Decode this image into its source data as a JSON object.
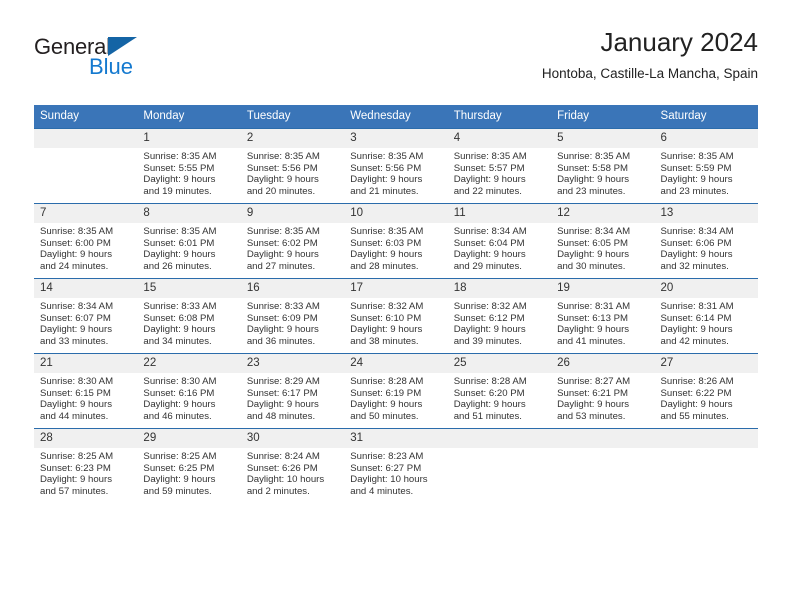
{
  "brand": {
    "name_part1": "General",
    "name_part2": "Blue",
    "accent_color": "#1479cf",
    "triangle_color": "#1464a5"
  },
  "header": {
    "title": "January 2024",
    "subtitle": "Hontoba, Castille-La Mancha, Spain"
  },
  "theme": {
    "header_blue": "#3a75b8",
    "row_line_blue": "#2b6cab",
    "daynum_band": "#f0f0f0"
  },
  "weekday_headers": [
    "Sunday",
    "Monday",
    "Tuesday",
    "Wednesday",
    "Thursday",
    "Friday",
    "Saturday"
  ],
  "weeks": [
    [
      {
        "day": "",
        "sunrise": "",
        "sunset": "",
        "daylight1": "",
        "daylight2": ""
      },
      {
        "day": "1",
        "sunrise": "Sunrise: 8:35 AM",
        "sunset": "Sunset: 5:55 PM",
        "daylight1": "Daylight: 9 hours",
        "daylight2": "and 19 minutes."
      },
      {
        "day": "2",
        "sunrise": "Sunrise: 8:35 AM",
        "sunset": "Sunset: 5:56 PM",
        "daylight1": "Daylight: 9 hours",
        "daylight2": "and 20 minutes."
      },
      {
        "day": "3",
        "sunrise": "Sunrise: 8:35 AM",
        "sunset": "Sunset: 5:56 PM",
        "daylight1": "Daylight: 9 hours",
        "daylight2": "and 21 minutes."
      },
      {
        "day": "4",
        "sunrise": "Sunrise: 8:35 AM",
        "sunset": "Sunset: 5:57 PM",
        "daylight1": "Daylight: 9 hours",
        "daylight2": "and 22 minutes."
      },
      {
        "day": "5",
        "sunrise": "Sunrise: 8:35 AM",
        "sunset": "Sunset: 5:58 PM",
        "daylight1": "Daylight: 9 hours",
        "daylight2": "and 23 minutes."
      },
      {
        "day": "6",
        "sunrise": "Sunrise: 8:35 AM",
        "sunset": "Sunset: 5:59 PM",
        "daylight1": "Daylight: 9 hours",
        "daylight2": "and 23 minutes."
      }
    ],
    [
      {
        "day": "7",
        "sunrise": "Sunrise: 8:35 AM",
        "sunset": "Sunset: 6:00 PM",
        "daylight1": "Daylight: 9 hours",
        "daylight2": "and 24 minutes."
      },
      {
        "day": "8",
        "sunrise": "Sunrise: 8:35 AM",
        "sunset": "Sunset: 6:01 PM",
        "daylight1": "Daylight: 9 hours",
        "daylight2": "and 26 minutes."
      },
      {
        "day": "9",
        "sunrise": "Sunrise: 8:35 AM",
        "sunset": "Sunset: 6:02 PM",
        "daylight1": "Daylight: 9 hours",
        "daylight2": "and 27 minutes."
      },
      {
        "day": "10",
        "sunrise": "Sunrise: 8:35 AM",
        "sunset": "Sunset: 6:03 PM",
        "daylight1": "Daylight: 9 hours",
        "daylight2": "and 28 minutes."
      },
      {
        "day": "11",
        "sunrise": "Sunrise: 8:34 AM",
        "sunset": "Sunset: 6:04 PM",
        "daylight1": "Daylight: 9 hours",
        "daylight2": "and 29 minutes."
      },
      {
        "day": "12",
        "sunrise": "Sunrise: 8:34 AM",
        "sunset": "Sunset: 6:05 PM",
        "daylight1": "Daylight: 9 hours",
        "daylight2": "and 30 minutes."
      },
      {
        "day": "13",
        "sunrise": "Sunrise: 8:34 AM",
        "sunset": "Sunset: 6:06 PM",
        "daylight1": "Daylight: 9 hours",
        "daylight2": "and 32 minutes."
      }
    ],
    [
      {
        "day": "14",
        "sunrise": "Sunrise: 8:34 AM",
        "sunset": "Sunset: 6:07 PM",
        "daylight1": "Daylight: 9 hours",
        "daylight2": "and 33 minutes."
      },
      {
        "day": "15",
        "sunrise": "Sunrise: 8:33 AM",
        "sunset": "Sunset: 6:08 PM",
        "daylight1": "Daylight: 9 hours",
        "daylight2": "and 34 minutes."
      },
      {
        "day": "16",
        "sunrise": "Sunrise: 8:33 AM",
        "sunset": "Sunset: 6:09 PM",
        "daylight1": "Daylight: 9 hours",
        "daylight2": "and 36 minutes."
      },
      {
        "day": "17",
        "sunrise": "Sunrise: 8:32 AM",
        "sunset": "Sunset: 6:10 PM",
        "daylight1": "Daylight: 9 hours",
        "daylight2": "and 38 minutes."
      },
      {
        "day": "18",
        "sunrise": "Sunrise: 8:32 AM",
        "sunset": "Sunset: 6:12 PM",
        "daylight1": "Daylight: 9 hours",
        "daylight2": "and 39 minutes."
      },
      {
        "day": "19",
        "sunrise": "Sunrise: 8:31 AM",
        "sunset": "Sunset: 6:13 PM",
        "daylight1": "Daylight: 9 hours",
        "daylight2": "and 41 minutes."
      },
      {
        "day": "20",
        "sunrise": "Sunrise: 8:31 AM",
        "sunset": "Sunset: 6:14 PM",
        "daylight1": "Daylight: 9 hours",
        "daylight2": "and 42 minutes."
      }
    ],
    [
      {
        "day": "21",
        "sunrise": "Sunrise: 8:30 AM",
        "sunset": "Sunset: 6:15 PM",
        "daylight1": "Daylight: 9 hours",
        "daylight2": "and 44 minutes."
      },
      {
        "day": "22",
        "sunrise": "Sunrise: 8:30 AM",
        "sunset": "Sunset: 6:16 PM",
        "daylight1": "Daylight: 9 hours",
        "daylight2": "and 46 minutes."
      },
      {
        "day": "23",
        "sunrise": "Sunrise: 8:29 AM",
        "sunset": "Sunset: 6:17 PM",
        "daylight1": "Daylight: 9 hours",
        "daylight2": "and 48 minutes."
      },
      {
        "day": "24",
        "sunrise": "Sunrise: 8:28 AM",
        "sunset": "Sunset: 6:19 PM",
        "daylight1": "Daylight: 9 hours",
        "daylight2": "and 50 minutes."
      },
      {
        "day": "25",
        "sunrise": "Sunrise: 8:28 AM",
        "sunset": "Sunset: 6:20 PM",
        "daylight1": "Daylight: 9 hours",
        "daylight2": "and 51 minutes."
      },
      {
        "day": "26",
        "sunrise": "Sunrise: 8:27 AM",
        "sunset": "Sunset: 6:21 PM",
        "daylight1": "Daylight: 9 hours",
        "daylight2": "and 53 minutes."
      },
      {
        "day": "27",
        "sunrise": "Sunrise: 8:26 AM",
        "sunset": "Sunset: 6:22 PM",
        "daylight1": "Daylight: 9 hours",
        "daylight2": "and 55 minutes."
      }
    ],
    [
      {
        "day": "28",
        "sunrise": "Sunrise: 8:25 AM",
        "sunset": "Sunset: 6:23 PM",
        "daylight1": "Daylight: 9 hours",
        "daylight2": "and 57 minutes."
      },
      {
        "day": "29",
        "sunrise": "Sunrise: 8:25 AM",
        "sunset": "Sunset: 6:25 PM",
        "daylight1": "Daylight: 9 hours",
        "daylight2": "and 59 minutes."
      },
      {
        "day": "30",
        "sunrise": "Sunrise: 8:24 AM",
        "sunset": "Sunset: 6:26 PM",
        "daylight1": "Daylight: 10 hours",
        "daylight2": "and 2 minutes."
      },
      {
        "day": "31",
        "sunrise": "Sunrise: 8:23 AM",
        "sunset": "Sunset: 6:27 PM",
        "daylight1": "Daylight: 10 hours",
        "daylight2": "and 4 minutes."
      },
      {
        "day": "",
        "sunrise": "",
        "sunset": "",
        "daylight1": "",
        "daylight2": ""
      },
      {
        "day": "",
        "sunrise": "",
        "sunset": "",
        "daylight1": "",
        "daylight2": ""
      },
      {
        "day": "",
        "sunrise": "",
        "sunset": "",
        "daylight1": "",
        "daylight2": ""
      }
    ]
  ]
}
